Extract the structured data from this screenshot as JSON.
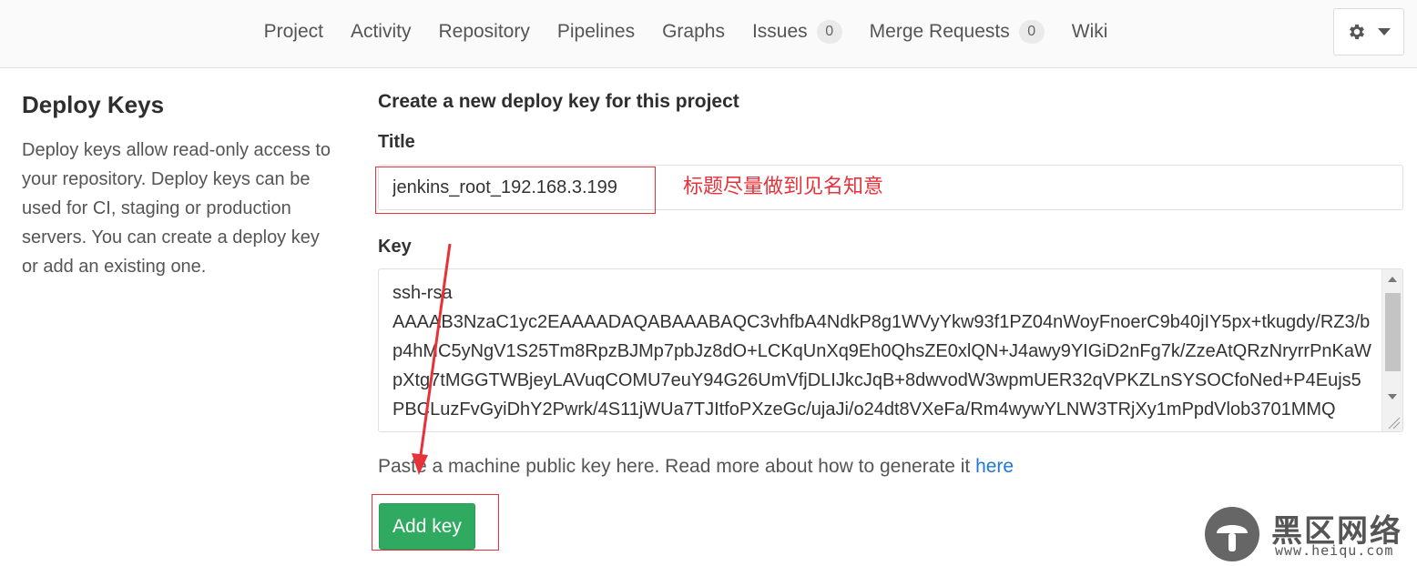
{
  "nav": {
    "items": [
      {
        "label": "Project"
      },
      {
        "label": "Activity"
      },
      {
        "label": "Repository"
      },
      {
        "label": "Pipelines"
      },
      {
        "label": "Graphs"
      },
      {
        "label": "Issues",
        "badge": "0"
      },
      {
        "label": "Merge Requests",
        "badge": "0"
      },
      {
        "label": "Wiki"
      }
    ],
    "settings_icon": "gear-icon",
    "settings_caret": "caret-down-icon"
  },
  "sidebar": {
    "title": "Deploy Keys",
    "description": "Deploy keys allow read-only access to your repository. Deploy keys can be used for CI, staging or production servers. You can create a deploy key or add an existing one."
  },
  "form": {
    "heading": "Create a new deploy key for this project",
    "title_label": "Title",
    "title_value": "jenkins_root_192.168.3.199",
    "key_label": "Key",
    "key_value": "ssh-rsa\nAAAAB3NzaC1yc2EAAAADAQABAAABAQC3vhfbA4NdkP8g1WVyYkw93f1PZ04nWoyFnoerC9b40jIY5px+tkugdy/RZ3/bp4hMC5yNgV1S25Tm8RpzBJMp7pbJz8dO+LCKqUnXq9Eh0QhsZE0xlQN+J4awy9YIGiD2nFg7k/ZzeAtQRzNryrrPnKaWpXtg7tMGGTWBjeyLAVuqCOMU7euY94G26UmVfjDLIJkcJqB+8dwvodW3wpmUER32qVPKZLnSYSOCfoNed+P4Eujs5PBCLuzFvGyiDhY2Pwrk/4S11jWUa7TJItfoPXzeGc/ujaJi/o24dt8VXeFa/Rm4wywYLNW3TRjXy1mPpdVlob3701MMQ",
    "help_text": "Paste a machine public key here. Read more about how to generate it",
    "help_link": "here",
    "submit_label": "Add key"
  },
  "annotation": {
    "note": "标题尽量做到见名知意",
    "color": "#e8323a"
  },
  "watermark": {
    "name": "黑区网络",
    "url": "www.heiqu.com"
  }
}
